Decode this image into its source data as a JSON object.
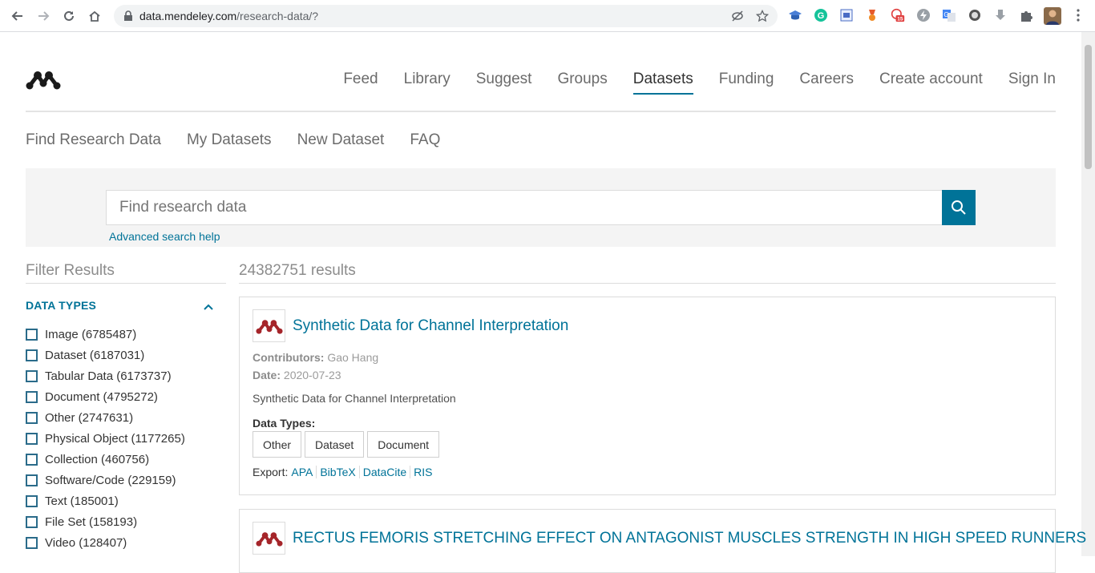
{
  "browser": {
    "url_host": "data.mendeley.com",
    "url_path": "/research-data/?",
    "extension_badge": "15"
  },
  "topnav": [
    "Feed",
    "Library",
    "Suggest",
    "Groups",
    "Datasets",
    "Funding",
    "Careers",
    "Create account",
    "Sign In"
  ],
  "topnav_active": "Datasets",
  "subnav": [
    "Find Research Data",
    "My Datasets",
    "New Dataset",
    "FAQ"
  ],
  "search": {
    "placeholder": "Find research data",
    "advanced_help": "Advanced search help"
  },
  "filters": {
    "title": "Filter Results",
    "section": "DATA TYPES",
    "items": [
      "Image (6785487)",
      "Dataset (6187031)",
      "Tabular Data (6173737)",
      "Document (4795272)",
      "Other (2747631)",
      "Physical Object (1177265)",
      "Collection (460756)",
      "Software/Code (229159)",
      "Text (185001)",
      "File Set (158193)",
      "Video (128407)"
    ]
  },
  "results": {
    "count_label": "24382751 results",
    "items": [
      {
        "title": "Synthetic Data for Channel Interpretation",
        "contributors_label": "Contributors:",
        "contributors": "Gao Hang",
        "date_label": "Date:",
        "date": "2020-07-23",
        "description": "Synthetic Data for Channel Interpretation",
        "data_types_label": "Data Types:",
        "data_types": [
          "Other",
          "Dataset",
          "Document"
        ],
        "export_label": "Export:",
        "export_links": [
          "APA",
          "BibTeX",
          "DataCite",
          "RIS"
        ]
      },
      {
        "title": "RECTUS FEMORIS STRETCHING EFFECT ON ANTAGONIST MUSCLES STRENGTH IN HIGH SPEED RUNNERS"
      }
    ]
  },
  "colors": {
    "accent": "#007398",
    "logo_red": "#a5252a"
  }
}
